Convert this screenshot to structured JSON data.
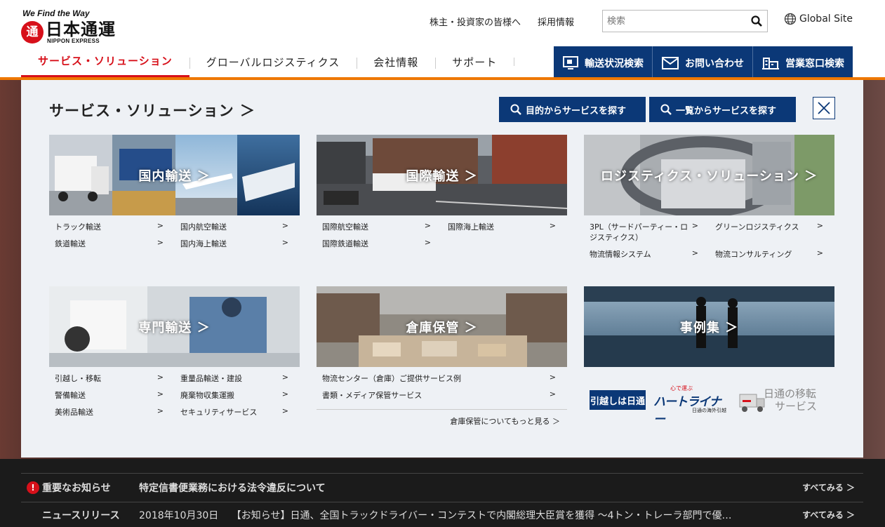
{
  "header": {
    "tagline": "We Find the Way",
    "seal_char": "通",
    "company_name": "日本通運",
    "company_name_en": "NIPPON EXPRESS",
    "top_links": [
      "株主・投資家の皆様へ",
      "採用情報"
    ],
    "search_placeholder": "検索",
    "global_site": "Global Site",
    "nav": [
      "サービス・ソリューション",
      "グローバルロジスティクス",
      "会社情報",
      "サポート"
    ],
    "quick_links": [
      "輸送状況検索",
      "お問い合わせ",
      "営業窓口検索"
    ]
  },
  "panel": {
    "title": "サービス・ソリューション ＞",
    "btn_purpose": "目的からサービスを探す",
    "btn_list": "一覧からサービスを探す",
    "cards": [
      {
        "label": "国内輸送 ＞",
        "links": [
          "トラック輸送",
          "国内航空輸送",
          "鉄道輸送",
          "国内海上輸送"
        ]
      },
      {
        "label": "国際輸送 ＞",
        "links": [
          "国際航空輸送",
          "国際海上輸送",
          "国際鉄道輸送"
        ]
      },
      {
        "label": "ロジスティクス・ソリューション ＞",
        "links": [
          "3PL（サードパーティー・ロジスティクス）",
          "グリーンロジスティクス",
          "物流情報システム",
          "物流コンサルティング"
        ]
      },
      {
        "label": "専門輸送 ＞",
        "links": [
          "引越し・移転",
          "重量品輸送・建設",
          "警備輸送",
          "廃棄物収集運搬",
          "美術品輸送",
          "セキュリティサービス"
        ]
      },
      {
        "label": "倉庫保管 ＞",
        "links": [
          "物流センター（倉庫）ご提供サービス例",
          "書類・メディア保管サービス"
        ],
        "more": "倉庫保管についてもっと見る ＞"
      },
      {
        "label": "事例集 ＞",
        "links": []
      }
    ],
    "logos": {
      "moving": "引越しは日通",
      "heartliner_small": "心で運ぶ",
      "heartliner": "ハートライナー",
      "heartliner_sub": "日通の海外引越",
      "overseas_line1": "日通の移転",
      "overseas_line2": "サービス"
    }
  },
  "news": {
    "important_label": "重要なお知らせ",
    "important_text": "特定信書便業務における法令違反について",
    "release_label": "ニュースリリース",
    "release_date": "2018年10月30日",
    "release_text": "【お知らせ】日通、全国トラックドライバー・コンテストで内閣総理大臣賞を獲得 ～4トン・トレーラ部門で優…",
    "see_all": "すべてみる ＞"
  }
}
